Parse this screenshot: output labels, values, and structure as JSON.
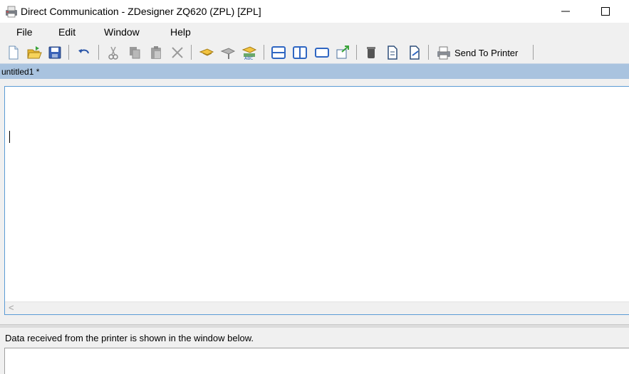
{
  "window": {
    "title": "Direct Communication - ZDesigner ZQ620 (ZPL) [ZPL]",
    "minimize_glyph": "—",
    "maximize_glyph": "☐"
  },
  "menu": {
    "items": [
      "File",
      "Edit",
      "Window",
      "Help"
    ]
  },
  "toolbar": {
    "send_label": "Send To Printer",
    "icons": [
      "new-file-icon",
      "open-folder-icon",
      "save-icon",
      "undo-icon",
      "cut-icon",
      "copy-icon",
      "paste-icon",
      "delete-icon",
      "send-file-icon",
      "receive-file-icon",
      "printer-settings-icon",
      "split-horizontal-icon",
      "split-vertical-icon",
      "single-window-icon",
      "export-icon",
      "trash-icon",
      "document-icon",
      "document-edit-icon",
      "printer-icon"
    ]
  },
  "document": {
    "tab_label": "untitled1 *"
  },
  "output": {
    "info_text": "Data received from the printer is shown in the window below."
  },
  "scrollbar": {
    "left_arrow": "<"
  }
}
